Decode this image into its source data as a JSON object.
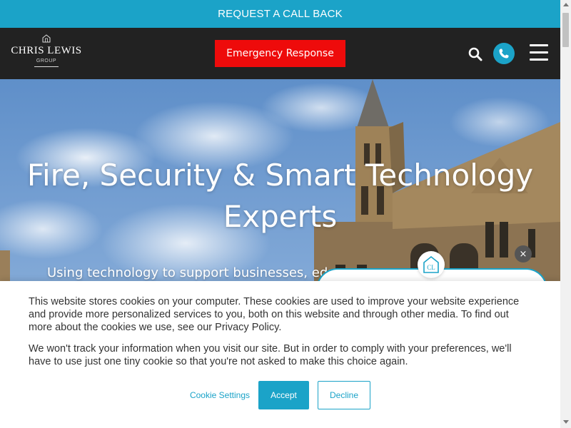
{
  "topbar": {
    "label": "REQUEST A CALL BACK"
  },
  "header": {
    "logo": {
      "name": "CHRIS LEWIS",
      "sub": "GROUP"
    },
    "emergency_label": "Emergency Response",
    "icons": {
      "search": "search-icon",
      "phone": "phone-icon",
      "menu": "hamburger-menu-icon"
    }
  },
  "hero": {
    "title": "Fire, Security & Smart Technology Experts",
    "subtitle": "Using technology to support businesses, educa"
  },
  "chat_widget": {
    "logo_text": "CL",
    "close_symbol": "×"
  },
  "cookie_banner": {
    "paragraph1": "This website stores cookies on your computer. These cookies are used to improve your website experience and provide more personalized services to you, both on this website and through other media. To find out more about the cookies we use, see our Privacy Policy.",
    "paragraph2": "We won't track your information when you visit our site. But in order to comply with your preferences, we'll have to use just one tiny cookie so that you're not asked to make this choice again.",
    "settings_label": "Cookie Settings",
    "accept_label": "Accept",
    "decline_label": "Decline"
  },
  "colors": {
    "accent": "#1ba3c8",
    "emergency": "#ee0b0b",
    "header_bg": "#222222"
  }
}
